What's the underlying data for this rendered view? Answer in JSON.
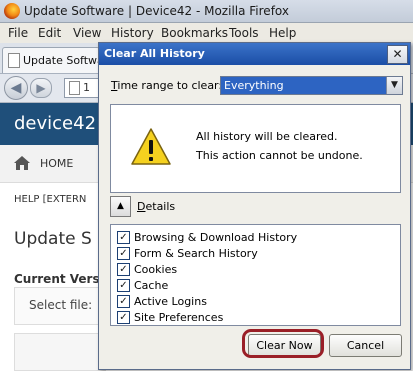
{
  "browser": {
    "window_title": "Update Software | Device42 - Mozilla Firefox",
    "menu": [
      "File",
      "Edit",
      "View",
      "History",
      "Bookmarks",
      "Tools",
      "Help"
    ],
    "tab_label": "Update Softwar",
    "url_text": "1"
  },
  "site": {
    "brand": "device42",
    "nav_home": "HOME",
    "breadcrumb": "HELP [EXTERN",
    "page_title": "Update S",
    "current_version_label": "Current Vers",
    "select_file_label": "Select file:"
  },
  "dialog": {
    "title": "Clear All History",
    "close_glyph": "✕",
    "time_range_label": "Time range to clear:",
    "time_range_value": "Everything",
    "warning_line1": "All history will be cleared.",
    "warning_line2": "This action cannot be undone.",
    "details_label": "Details",
    "items": [
      {
        "label": "Browsing & Download History",
        "checked": true
      },
      {
        "label": "Form & Search History",
        "checked": true
      },
      {
        "label": "Cookies",
        "checked": true
      },
      {
        "label": "Cache",
        "checked": true
      },
      {
        "label": "Active Logins",
        "checked": true
      },
      {
        "label": "Site Preferences",
        "checked": true
      }
    ],
    "clear_now_label": "Clear Now",
    "cancel_label": "Cancel"
  },
  "colors": {
    "dialog_title_bar": "#1b4ea6",
    "site_header": "#1f4f7a",
    "highlight_ring": "#9a1f27",
    "selection": "#2d64c2"
  }
}
